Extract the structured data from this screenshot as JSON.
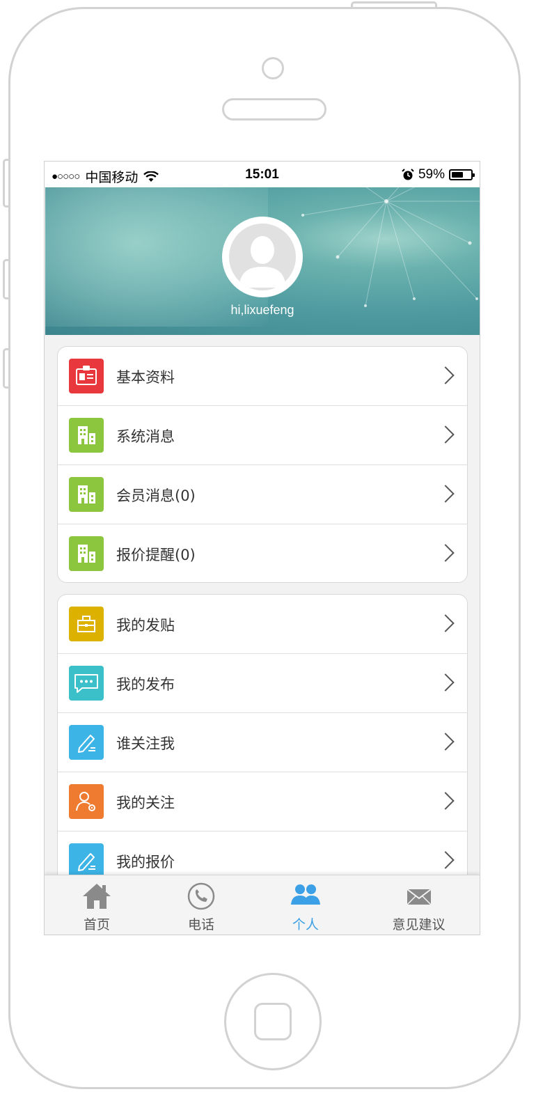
{
  "status_bar": {
    "signal": "●○○○○",
    "carrier": "中国移动",
    "time": "15:01",
    "battery_percent": "59%",
    "battery_level": 0.59
  },
  "profile": {
    "greeting": "hi,lixuefeng"
  },
  "menu_group_1": [
    {
      "label": "基本资料",
      "icon": "id-card-icon",
      "color": "#e8383d"
    },
    {
      "label": "系统消息",
      "icon": "building-icon",
      "color": "#8cc63f"
    },
    {
      "label": "会员消息(0)",
      "icon": "building-icon",
      "color": "#8cc63f"
    },
    {
      "label": "报价提醒(0)",
      "icon": "building-icon",
      "color": "#8cc63f"
    }
  ],
  "menu_group_2": [
    {
      "label": "我的发贴",
      "icon": "briefcase-icon",
      "color": "#dcb100"
    },
    {
      "label": "我的发布",
      "icon": "chat-bubble-icon",
      "color": "#3bbfc8"
    },
    {
      "label": "谁关注我",
      "icon": "pencil-icon",
      "color": "#3cb4e6"
    },
    {
      "label": "我的关注",
      "icon": "user-settings-icon",
      "color": "#ee7b2f"
    },
    {
      "label": "我的报价",
      "icon": "pencil-icon",
      "color": "#3cb4e6"
    }
  ],
  "tab_bar": {
    "tabs": [
      {
        "label": "首页",
        "icon": "home-icon"
      },
      {
        "label": "电话",
        "icon": "phone-icon"
      },
      {
        "label": "个人",
        "icon": "users-icon",
        "active": true
      },
      {
        "label": "意见建议",
        "icon": "mail-icon"
      }
    ],
    "active_color": "#3ba0e6"
  }
}
